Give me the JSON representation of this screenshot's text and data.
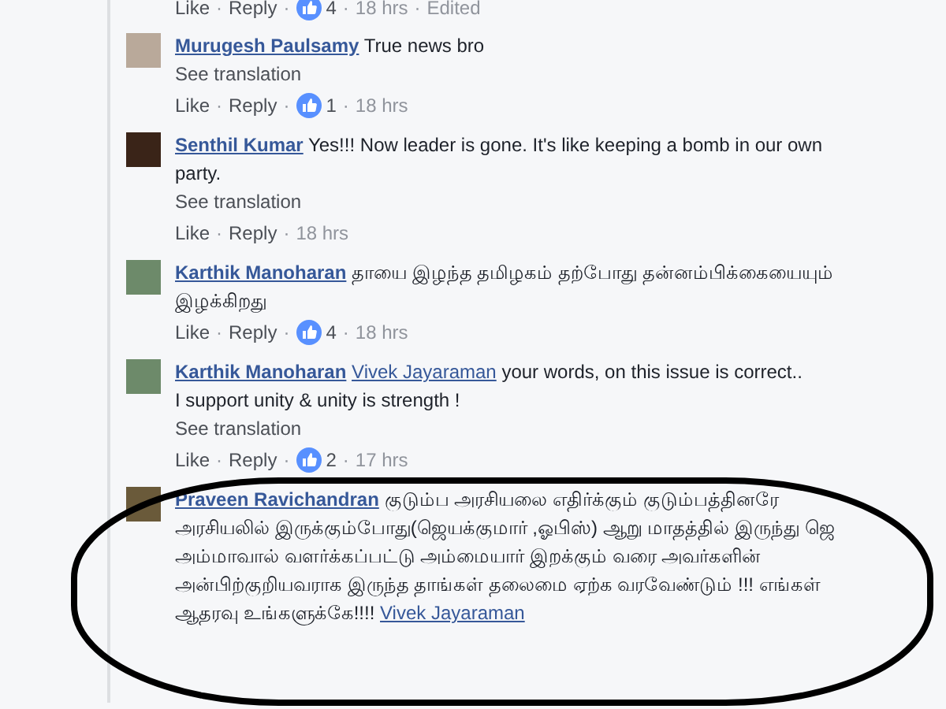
{
  "separator": "·",
  "top_actions": {
    "like": "Like",
    "reply": "Reply",
    "reactions": "4",
    "time": "18 hrs",
    "edited": "Edited"
  },
  "comments": [
    {
      "author": "Murugesh Paulsamy",
      "parts": [
        {
          "kind": "text",
          "text": "True news bro"
        }
      ],
      "see_translation": "See translation",
      "like": "Like",
      "reply": "Reply",
      "reactions": "1",
      "time": "18 hrs"
    },
    {
      "author": "Senthil Kumar",
      "parts": [
        {
          "kind": "text",
          "text": "Yes!!! Now leader is gone. It's like keeping a bomb in our own party."
        }
      ],
      "see_translation": "See translation",
      "like": "Like",
      "reply": "Reply",
      "time": "18 hrs"
    },
    {
      "author": "Karthik Manoharan",
      "parts": [
        {
          "kind": "text",
          "text": "தாயை இழந்த தமிழகம் தற்போது தன்னம்பிக்கையையும் இழக்கிறது"
        }
      ],
      "like": "Like",
      "reply": "Reply",
      "reactions": "4",
      "time": "18 hrs"
    },
    {
      "author": "Karthik Manoharan",
      "parts": [
        {
          "kind": "mention",
          "text": "Vivek Jayaraman"
        },
        {
          "kind": "text",
          "text": "your words, on this issue is correct.."
        },
        {
          "kind": "break"
        },
        {
          "kind": "text",
          "text": "I support unity & unity is strength !"
        }
      ],
      "see_translation": "See translation",
      "like": "Like",
      "reply": "Reply",
      "reactions": "2",
      "time": "17 hrs"
    },
    {
      "author": "Praveen Ravichandran",
      "parts": [
        {
          "kind": "text",
          "text": "குடும்ப அரசியலை எதிர்க்கும் குடும்பத்தினரே அரசியலில் இருக்கும்போது(ஜெயக்குமார் ,ஓபிஸ்) ஆறு மாதத்தில் இருந்து ஜெ அம்மாவால் வளர்க்கப்பட்டு அம்மையார் இறக்கும் வரை அவர்களின் அன்பிற்குறியவராக இருந்த தாங்கள் தலைமை ஏற்க வரவேண்டும் !!! எங்கள் ஆதரவு உங்களுக்கே!!!!"
        },
        {
          "kind": "mention",
          "text": "Vivek Jayaraman"
        }
      ]
    }
  ]
}
